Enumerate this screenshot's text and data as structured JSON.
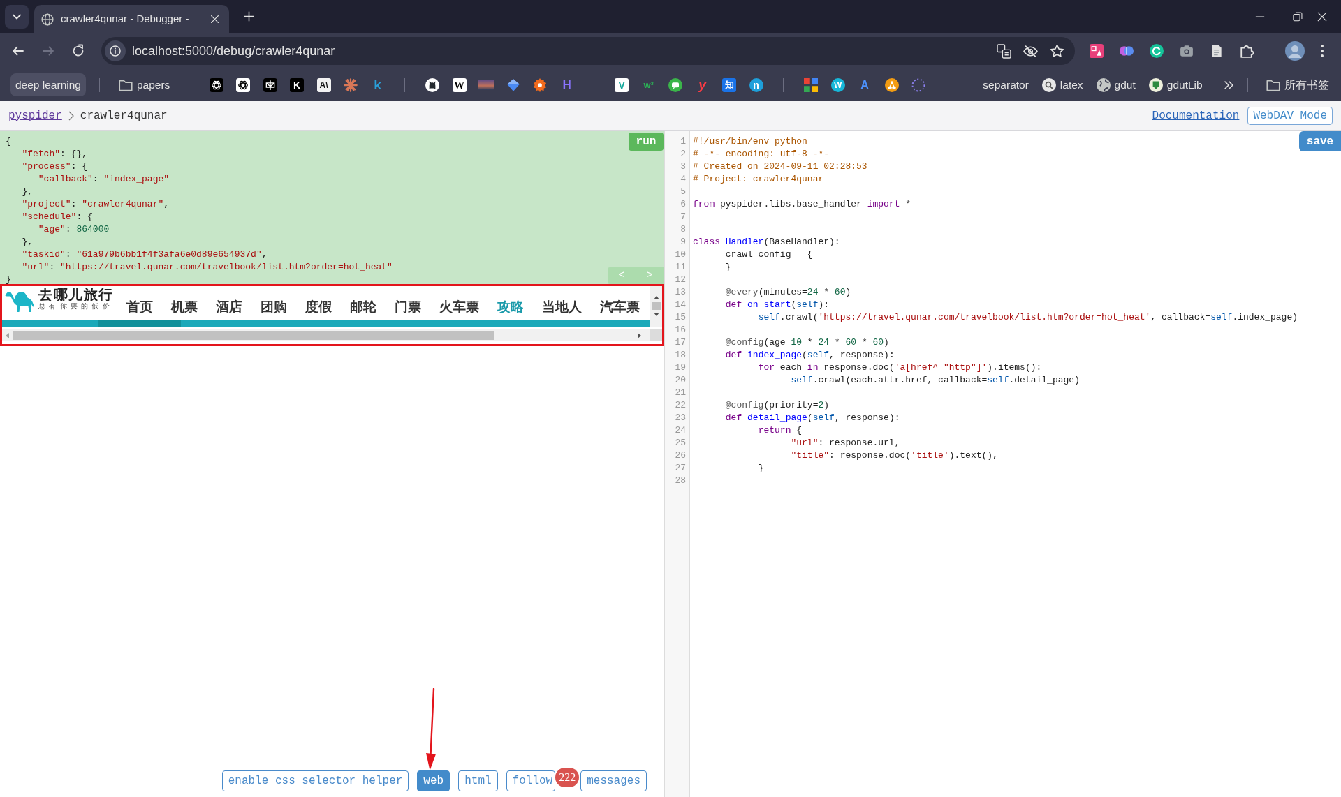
{
  "browser": {
    "tab": {
      "title": "crawler4qunar - Debugger -"
    },
    "navigation": {
      "back_enabled": true,
      "forward_enabled": false
    },
    "address": "localhost:5000/debug/crawler4qunar",
    "bookmarks": [
      {
        "kind": "link",
        "label": "deep learning",
        "highlighted": true
      },
      {
        "kind": "separator"
      },
      {
        "kind": "folder",
        "label": "papers",
        "highlighted": false
      },
      {
        "kind": "separator"
      },
      {
        "kind": "site"
      },
      {
        "kind": "site"
      },
      {
        "kind": "site"
      },
      {
        "kind": "letter",
        "glyph": "K"
      },
      {
        "kind": "letter",
        "glyph": "A\\"
      },
      {
        "kind": "site"
      },
      {
        "kind": "letter",
        "glyph": "k"
      },
      {
        "kind": "separator"
      },
      {
        "kind": "site"
      },
      {
        "kind": "letter",
        "glyph": "W"
      },
      {
        "kind": "site"
      },
      {
        "kind": "site"
      },
      {
        "kind": "site"
      },
      {
        "kind": "letter",
        "glyph": "H"
      },
      {
        "kind": "separator"
      },
      {
        "kind": "letter",
        "glyph": "V"
      },
      {
        "kind": "letter",
        "glyph": "w³"
      },
      {
        "kind": "site"
      },
      {
        "kind": "letter",
        "glyph": "y"
      },
      {
        "kind": "letter",
        "glyph": "知"
      },
      {
        "kind": "letter",
        "glyph": "n"
      },
      {
        "kind": "separator"
      },
      {
        "kind": "site"
      },
      {
        "kind": "letter",
        "glyph": "W"
      },
      {
        "kind": "letter",
        "glyph": "A"
      },
      {
        "kind": "site"
      },
      {
        "kind": "site"
      },
      {
        "kind": "separator"
      },
      {
        "kind": "link",
        "label": "separator",
        "highlighted": false
      },
      {
        "kind": "link",
        "label": "latex",
        "highlighted": false
      },
      {
        "kind": "link",
        "label": "gdut",
        "highlighted": false
      },
      {
        "kind": "link",
        "label": "gdutLib",
        "highlighted": false
      },
      {
        "kind": "overflow"
      },
      {
        "kind": "separator"
      },
      {
        "kind": "folder",
        "label": "所有书签",
        "highlighted": false
      }
    ]
  },
  "header": {
    "breadcrumb": [
      {
        "kind": "link",
        "label": "pyspider"
      },
      {
        "kind": "current",
        "label": "crawler4qunar"
      }
    ],
    "documentation_link": "Documentation",
    "webdav_button": "WebDAV Mode"
  },
  "task_panel": {
    "run_button": "run",
    "history_back": "<",
    "history_forward": ">",
    "lines": [
      [
        {
          "kind": "plain",
          "text": "{"
        }
      ],
      [
        {
          "kind": "string",
          "text": "\t\"fetch\""
        },
        {
          "kind": "plain",
          "text": ": {},"
        }
      ],
      [
        {
          "kind": "string",
          "text": "\t\"process\""
        },
        {
          "kind": "plain",
          "text": ": {"
        }
      ],
      [
        {
          "kind": "string",
          "text": "\t\t\"callback\""
        },
        {
          "kind": "plain",
          "text": ": "
        },
        {
          "kind": "string",
          "text": "\"index_page\""
        }
      ],
      [
        {
          "kind": "plain",
          "text": "\t},"
        }
      ],
      [
        {
          "kind": "string",
          "text": "\t\"project\""
        },
        {
          "kind": "plain",
          "text": ": "
        },
        {
          "kind": "string",
          "text": "\"crawler4qunar\""
        },
        {
          "kind": "plain",
          "text": ","
        }
      ],
      [
        {
          "kind": "string",
          "text": "\t\"schedule\""
        },
        {
          "kind": "plain",
          "text": ": {"
        }
      ],
      [
        {
          "kind": "string",
          "text": "\t\t\"age\""
        },
        {
          "kind": "plain",
          "text": ": "
        },
        {
          "kind": "number",
          "text": "864000"
        }
      ],
      [
        {
          "kind": "plain",
          "text": "\t},"
        }
      ],
      [
        {
          "kind": "string",
          "text": "\t\"taskid\""
        },
        {
          "kind": "plain",
          "text": ": "
        },
        {
          "kind": "string",
          "text": "\"61a979b6bb1f4f3afa6e0d89e654937d\""
        },
        {
          "kind": "plain",
          "text": ","
        }
      ],
      [
        {
          "kind": "string",
          "text": "\t\"url\""
        },
        {
          "kind": "plain",
          "text": ": "
        },
        {
          "kind": "string",
          "text": "\"https://travel.qunar.com/travelbook/list.htm?order=hot_heat\""
        }
      ],
      [
        {
          "kind": "plain",
          "text": "}"
        }
      ]
    ]
  },
  "preview": {
    "outlined": true,
    "logo_name": "去哪儿旅行",
    "logo_slogan": "总有你要的低价",
    "nav": [
      {
        "label": "首页",
        "selected": false
      },
      {
        "label": "机票",
        "selected": false
      },
      {
        "label": "酒店",
        "selected": false
      },
      {
        "label": "团购",
        "selected": false
      },
      {
        "label": "度假",
        "selected": false
      },
      {
        "label": "邮轮",
        "selected": false
      },
      {
        "label": "门票",
        "selected": false
      },
      {
        "label": "火车票",
        "selected": false
      },
      {
        "label": "攻略",
        "selected": true
      },
      {
        "label": "当地人",
        "selected": false
      },
      {
        "label": "汽车票",
        "selected": false
      }
    ]
  },
  "toolbar": {
    "buttons": [
      {
        "label": "enable css selector helper",
        "selected": false,
        "arrow_marked": false
      },
      {
        "label": "web",
        "selected": true,
        "arrow_marked": true
      },
      {
        "label": "html",
        "selected": false,
        "arrow_marked": false
      },
      {
        "label": "follow",
        "selected": false,
        "arrow_marked": false,
        "badge": "222"
      },
      {
        "label": "messages",
        "selected": false,
        "arrow_marked": false
      }
    ]
  },
  "editor": {
    "save_button": "save",
    "lines": [
      {
        "number": "1",
        "tokens": [
          {
            "kind": "comment",
            "text": "#!/usr/bin/env python"
          }
        ]
      },
      {
        "number": "2",
        "tokens": [
          {
            "kind": "comment",
            "text": "# -*- encoding: utf-8 -*-"
          }
        ]
      },
      {
        "number": "3",
        "tokens": [
          {
            "kind": "comment",
            "text": "# Created on 2024-09-11 02:28:53"
          }
        ]
      },
      {
        "number": "4",
        "tokens": [
          {
            "kind": "comment",
            "text": "# Project: crawler4qunar"
          }
        ]
      },
      {
        "number": "5"
      },
      {
        "number": "6",
        "tokens": [
          {
            "kind": "keyword",
            "text": "from"
          },
          {
            "kind": "plain",
            "text": " pyspider.libs.base_handler "
          },
          {
            "kind": "keyword",
            "text": "import"
          },
          {
            "kind": "plain",
            "text": " *"
          }
        ]
      },
      {
        "number": "7"
      },
      {
        "number": "8"
      },
      {
        "number": "9",
        "tokens": [
          {
            "kind": "keyword",
            "text": "class "
          },
          {
            "kind": "def",
            "text": "Handler"
          },
          {
            "kind": "plain",
            "text": "(BaseHandler):"
          }
        ]
      },
      {
        "number": "10",
        "tokens": [
          {
            "kind": "plain",
            "text": "\tcrawl_config = {"
          }
        ]
      },
      {
        "number": "11",
        "tokens": [
          {
            "kind": "plain",
            "text": "\t}"
          }
        ]
      },
      {
        "number": "12"
      },
      {
        "number": "13",
        "tokens": [
          {
            "kind": "meta",
            "text": "\t@every"
          },
          {
            "kind": "plain",
            "text": "(minutes="
          },
          {
            "kind": "number",
            "text": "24"
          },
          {
            "kind": "plain",
            "text": " * "
          },
          {
            "kind": "number",
            "text": "60"
          },
          {
            "kind": "plain",
            "text": ")"
          }
        ]
      },
      {
        "number": "14",
        "tokens": [
          {
            "kind": "keyword",
            "text": "\tdef "
          },
          {
            "kind": "def",
            "text": "on_start"
          },
          {
            "kind": "plain",
            "text": "("
          },
          {
            "kind": "variable",
            "text": "self"
          },
          {
            "kind": "plain",
            "text": "):"
          }
        ]
      },
      {
        "number": "15",
        "tokens": [
          {
            "kind": "variable",
            "text": "\t\tself"
          },
          {
            "kind": "plain",
            "text": ".crawl("
          },
          {
            "kind": "string",
            "text": "'https://travel.qunar.com/travelbook/list.htm?order=hot_heat'"
          },
          {
            "kind": "plain",
            "text": ", callback="
          },
          {
            "kind": "variable",
            "text": "self"
          },
          {
            "kind": "plain",
            "text": ".index_page)"
          }
        ]
      },
      {
        "number": "16"
      },
      {
        "number": "17",
        "tokens": [
          {
            "kind": "meta",
            "text": "\t@config"
          },
          {
            "kind": "plain",
            "text": "(age="
          },
          {
            "kind": "number",
            "text": "10"
          },
          {
            "kind": "plain",
            "text": " * "
          },
          {
            "kind": "number",
            "text": "24"
          },
          {
            "kind": "plain",
            "text": " * "
          },
          {
            "kind": "number",
            "text": "60"
          },
          {
            "kind": "plain",
            "text": " * "
          },
          {
            "kind": "number",
            "text": "60"
          },
          {
            "kind": "plain",
            "text": ")"
          }
        ]
      },
      {
        "number": "18",
        "tokens": [
          {
            "kind": "keyword",
            "text": "\tdef "
          },
          {
            "kind": "def",
            "text": "index_page"
          },
          {
            "kind": "plain",
            "text": "("
          },
          {
            "kind": "variable",
            "text": "self"
          },
          {
            "kind": "plain",
            "text": ", response):"
          }
        ]
      },
      {
        "number": "19",
        "tokens": [
          {
            "kind": "keyword",
            "text": "\t\tfor"
          },
          {
            "kind": "plain",
            "text": " each "
          },
          {
            "kind": "keyword",
            "text": "in"
          },
          {
            "kind": "plain",
            "text": " response.doc("
          },
          {
            "kind": "string",
            "text": "'a[href^=\"http\"]'"
          },
          {
            "kind": "plain",
            "text": ").items():"
          }
        ]
      },
      {
        "number": "20",
        "tokens": [
          {
            "kind": "variable",
            "text": "\t\t\tself"
          },
          {
            "kind": "plain",
            "text": ".crawl(each.attr.href, callback="
          },
          {
            "kind": "variable",
            "text": "self"
          },
          {
            "kind": "plain",
            "text": ".detail_page)"
          }
        ]
      },
      {
        "number": "21"
      },
      {
        "number": "22",
        "tokens": [
          {
            "kind": "meta",
            "text": "\t@config"
          },
          {
            "kind": "plain",
            "text": "(priority="
          },
          {
            "kind": "number",
            "text": "2"
          },
          {
            "kind": "plain",
            "text": ")"
          }
        ]
      },
      {
        "number": "23",
        "tokens": [
          {
            "kind": "keyword",
            "text": "\tdef "
          },
          {
            "kind": "def",
            "text": "detail_page"
          },
          {
            "kind": "plain",
            "text": "("
          },
          {
            "kind": "variable",
            "text": "self"
          },
          {
            "kind": "plain",
            "text": ", response):"
          }
        ]
      },
      {
        "number": "24",
        "tokens": [
          {
            "kind": "keyword",
            "text": "\t\treturn"
          },
          {
            "kind": "plain",
            "text": " {"
          }
        ]
      },
      {
        "number": "25",
        "tokens": [
          {
            "kind": "string",
            "text": "\t\t\t\"url\""
          },
          {
            "kind": "plain",
            "text": ": response.url,"
          }
        ]
      },
      {
        "number": "26",
        "tokens": [
          {
            "kind": "string",
            "text": "\t\t\t\"title\""
          },
          {
            "kind": "plain",
            "text": ": response.doc("
          },
          {
            "kind": "string",
            "text": "'title'"
          },
          {
            "kind": "plain",
            "text": ").text(),"
          }
        ]
      },
      {
        "number": "27",
        "tokens": [
          {
            "kind": "plain",
            "text": "\t\t}"
          }
        ]
      },
      {
        "number": "28"
      }
    ]
  }
}
